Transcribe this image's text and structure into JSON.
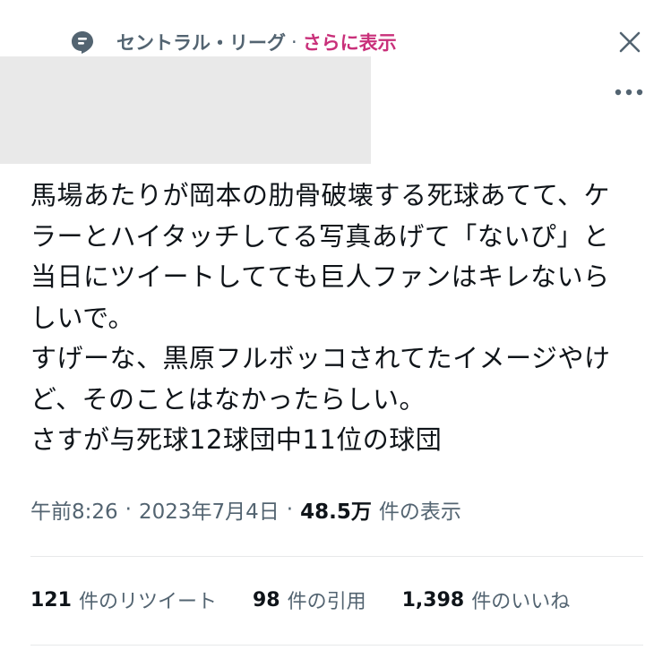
{
  "topic": {
    "icon": "topic-chat-icon",
    "name": "セントラル・リーグ",
    "separator": "·",
    "more_label": "さらに表示"
  },
  "controls": {
    "close_icon": "close-icon",
    "more_icon": "more-options-icon"
  },
  "tweet": {
    "text": "馬場あたりが岡本の肋骨破壊する死球あてて、ケ\nラーとハイタッチしてる写真あげて「ないぴ」と\n当日にツイートしてても巨人ファンはキレないら\nしいで。\nすげーな、黒原フルボッコされてたイメージやけ\nど、そのことはなかったらしい。\nさすが与死球12球団中11位の球団"
  },
  "meta": {
    "time": "午前8:26",
    "separator": "·",
    "date": "2023年7月4日",
    "views_count": "48.5万",
    "views_label": "件の表示"
  },
  "stats": {
    "retweets_count": "121",
    "retweets_label": "件のリツイート",
    "quotes_count": "98",
    "quotes_label": "件の引用",
    "likes_count": "1,398",
    "likes_label": "件のいいね"
  },
  "colors": {
    "text": "#0f1419",
    "secondary": "#536471",
    "accent": "#c9307a",
    "divider": "#e7e9ea"
  }
}
